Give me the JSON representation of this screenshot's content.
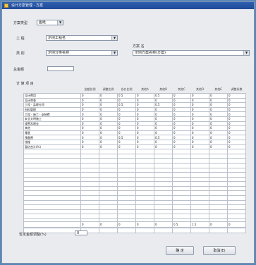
{
  "window": {
    "title": "设计方案管理 - 方案"
  },
  "form": {
    "type_label": "方案类型",
    "type_value": "图纸",
    "project_label": "工 程",
    "project_value": "示例工程名",
    "unit_label": "类 别",
    "unit_value": "示例分类名称",
    "scheme_label": "方案 名",
    "scheme_value": "示例方案名称(方案)",
    "amount_label": "总金额",
    "amount_value": "",
    "list_label": "计 算 项 目"
  },
  "grid": {
    "headers": [
      "",
      "金额比例",
      "调整比例",
      "合价比例",
      "其他A",
      "其他B",
      "其他C",
      "其他D",
      "其他E",
      "调整系数"
    ],
    "rows": [
      [
        "设计费用",
        "0",
        "0",
        "0.5",
        "0",
        "0.5",
        "0",
        "0",
        "0",
        "0"
      ],
      [
        "设计审查",
        "0",
        "0",
        "0",
        "0",
        "0",
        "0",
        "0",
        "0",
        "0"
      ],
      [
        "工程 · 监理分项",
        "0",
        "0",
        "0.5",
        "0",
        "0.5",
        "0",
        "0",
        "0",
        "0"
      ],
      [
        "材料管理",
        "0",
        "0",
        "0",
        "0",
        "0",
        "0",
        "0",
        "0",
        "0"
      ],
      [
        "工程 · 施工 · 安装费",
        "0",
        "0",
        "0",
        "0",
        "0",
        "0",
        "0",
        "0",
        "0"
      ],
      [
        "安全文明施工",
        "0",
        "0",
        "0",
        "0",
        "0",
        "0",
        "0",
        "0",
        "0"
      ],
      [
        "规费及税金",
        "0",
        "0",
        "0",
        "0",
        "0",
        "0",
        "0",
        "0",
        "0"
      ],
      [
        "其他",
        "0",
        "0",
        "0",
        "0",
        "0",
        "0",
        "0",
        "0",
        "0"
      ],
      [
        "零星",
        "0",
        "0",
        "0",
        "0",
        "0",
        "0",
        "0",
        "0",
        "0"
      ],
      [
        "预备费",
        "0",
        "0",
        "0.5",
        "0",
        "0.5",
        "0",
        "0",
        "0",
        "0"
      ],
      [
        "措施",
        "0",
        "0",
        "0",
        "0",
        "0",
        "0",
        "0",
        "0",
        "0"
      ],
      [
        "暂估合计(%)",
        "0",
        "0",
        "0",
        "0",
        "0",
        "0",
        "0",
        "0",
        "0"
      ],
      [
        "",
        "",
        "",
        "",
        "",
        "",
        "",
        "",
        "",
        ""
      ],
      [
        "",
        "",
        "",
        "",
        "",
        "",
        "",
        "",
        "",
        ""
      ],
      [
        "",
        "",
        "",
        "",
        "",
        "",
        "",
        "",
        "",
        ""
      ],
      [
        "",
        "",
        "",
        "",
        "",
        "",
        "",
        "",
        "",
        ""
      ],
      [
        "",
        "",
        "",
        "",
        "",
        "",
        "",
        "",
        "",
        ""
      ],
      [
        "",
        "",
        "",
        "",
        "",
        "",
        "",
        "",
        "",
        ""
      ],
      [
        "",
        "",
        "",
        "",
        "",
        "",
        "",
        "",
        "",
        ""
      ],
      [
        "",
        "",
        "",
        "",
        "",
        "",
        "",
        "",
        "",
        ""
      ],
      [
        "",
        "",
        "",
        "",
        "",
        "",
        "",
        "",
        "",
        ""
      ],
      [
        "",
        "",
        "",
        "",
        "",
        "",
        "",
        "",
        "",
        ""
      ],
      [
        "",
        "",
        "",
        "",
        "",
        "",
        "",
        "",
        "",
        ""
      ],
      [
        "",
        "",
        "",
        "",
        "",
        "",
        "",
        "",
        "",
        ""
      ],
      [
        "",
        "",
        "",
        "",
        "",
        "",
        "",
        "",
        "",
        ""
      ],
      [
        "",
        "",
        "",
        "",
        "",
        "",
        "",
        "",
        "",
        ""
      ],
      [
        "",
        "",
        "",
        "",
        "",
        "",
        "",
        "",
        "",
        ""
      ],
      [
        "",
        "",
        "",
        "",
        "",
        "",
        "",
        "",
        "",
        ""
      ],
      [
        "",
        "",
        "",
        "",
        "",
        "",
        "",
        "",
        "",
        ""
      ],
      [
        "",
        "",
        "",
        "",
        "",
        "",
        "",
        "",
        "",
        ""
      ]
    ],
    "totals": [
      "",
      "0",
      "0",
      "0",
      "0",
      "0",
      "0.5",
      "1.5",
      "0",
      "0"
    ]
  },
  "footer": {
    "rate_label": "暂定金额调整(%)",
    "rate_value": "0",
    "ok_label": "确 定",
    "cancel_label": "取消(E)"
  }
}
